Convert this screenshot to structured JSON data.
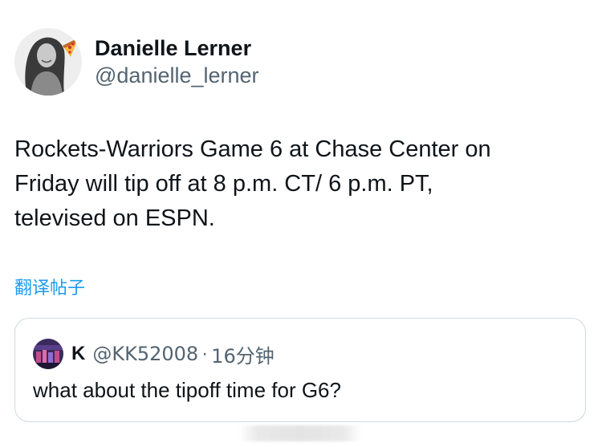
{
  "author": {
    "display_name": "Danielle Lerner",
    "handle": "@danielle_lerner"
  },
  "tweet": {
    "lines": [
      "Rockets-Warriors Game 6 at Chase Center on",
      "Friday will tip off at 8 p.m. CT/ 6 p.m. PT,",
      "televised on ESPN."
    ],
    "translate_label": "翻译帖子"
  },
  "quoted_tweet": {
    "name": "K",
    "handle": "@KK52008",
    "separator": "·",
    "time": "16分钟",
    "text": "what about the tipoff time for G6?"
  },
  "icons": [
    "profile-photo",
    "pizza-emoji-icon",
    "quote-author-avatar"
  ],
  "colors": {
    "text": "#0f1419",
    "secondary": "#536471",
    "link": "#1d9bf0",
    "border": "#cfd9de"
  }
}
